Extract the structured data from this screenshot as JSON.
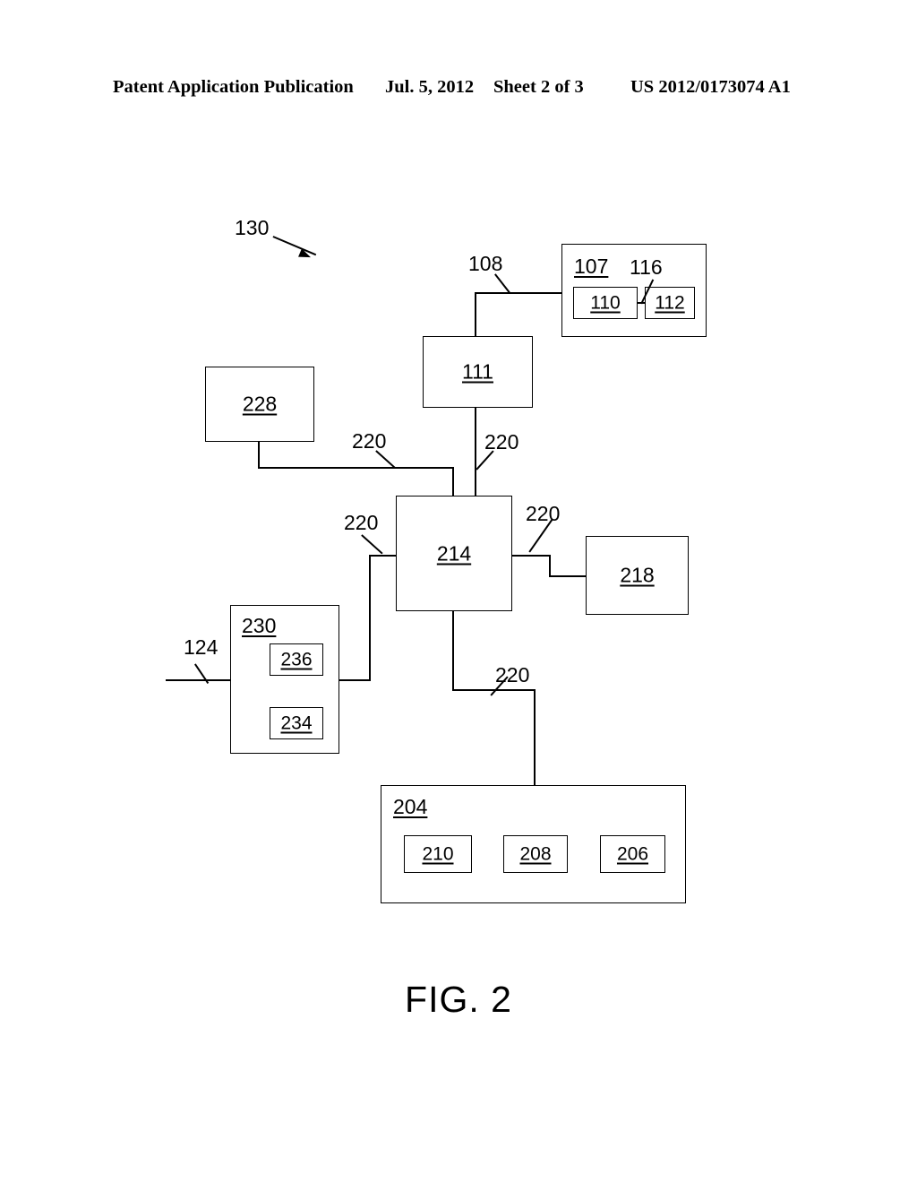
{
  "header": {
    "publication": "Patent Application Publication",
    "date": "Jul. 5, 2012",
    "sheet": "Sheet 2 of 3",
    "patent_number": "US 2012/0173074 A1"
  },
  "figure": {
    "caption": "FIG. 2",
    "overall_ref": "130",
    "boxes": {
      "b107": "107",
      "b110": "110",
      "b112": "112",
      "b111": "111",
      "b228": "228",
      "b214": "214",
      "b218": "218",
      "b230": "230",
      "b236": "236",
      "b234": "234",
      "b204": "204",
      "b210": "210",
      "b208": "208",
      "b206": "206"
    },
    "lead_labels": {
      "l108": "108",
      "l116": "116",
      "l124": "124",
      "l220_a": "220",
      "l220_b": "220",
      "l220_c": "220",
      "l220_d": "220",
      "l220_e": "220"
    }
  }
}
